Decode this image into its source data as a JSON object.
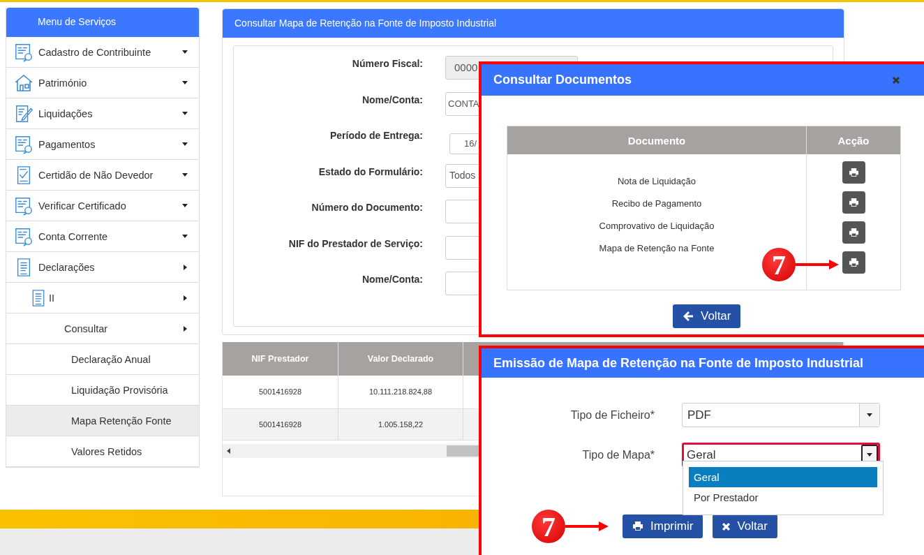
{
  "sidebar": {
    "title": "Menu de Serviços",
    "items": [
      {
        "label": "Cadastro de Contribuinte",
        "expanded": false,
        "selected": false
      },
      {
        "label": "Património",
        "expanded": false,
        "selected": false
      },
      {
        "label": "Liquidações",
        "expanded": false,
        "selected": false
      },
      {
        "label": "Pagamentos",
        "expanded": false,
        "selected": false
      },
      {
        "label": "Certidão de Não Devedor",
        "expanded": false,
        "selected": false
      },
      {
        "label": "Verificar Certificado",
        "expanded": false,
        "selected": false
      },
      {
        "label": "Conta Corrente",
        "expanded": false,
        "selected": false
      },
      {
        "label": "Declarações",
        "expanded": true,
        "selected": false,
        "children": [
          {
            "label": "II",
            "expanded": true,
            "selected": false,
            "children": [
              {
                "label": "Consultar",
                "expanded": true,
                "selected": false,
                "children": [
                  {
                    "label": "Declaração Anual",
                    "selected": false
                  },
                  {
                    "label": "Liquidação Provisória",
                    "selected": false
                  },
                  {
                    "label": "Mapa Retenção Fonte",
                    "selected": true
                  },
                  {
                    "label": "Valores Retidos",
                    "selected": false
                  }
                ]
              }
            ]
          }
        ]
      }
    ]
  },
  "panel": {
    "title": "Consultar Mapa de Retenção na Fonte de Imposto Industrial",
    "fields": [
      {
        "label": "Número Fiscal:",
        "value": "0000",
        "kind": "readonly"
      },
      {
        "label": "Nome/Conta:",
        "value": "CONTA",
        "kind": "text"
      },
      {
        "label": "Período de Entrega:",
        "value": "16/",
        "kind": "date"
      },
      {
        "label": "Estado do Formulário:",
        "value": "Todos",
        "kind": "select"
      },
      {
        "label": "Número do Documento:",
        "kind": "text"
      },
      {
        "label": "NIF do Prestador de Serviço:",
        "kind": "text"
      },
      {
        "label": "Nome/Conta:",
        "kind": "text"
      }
    ]
  },
  "table": {
    "columns": [
      "NIF Prestador",
      "Valor Declarado"
    ],
    "rows": [
      [
        "5001416928",
        "10.111.218.824,88"
      ],
      [
        "5001416928",
        "1.005.158,22"
      ]
    ]
  },
  "documents_dialog": {
    "title": "Consultar Documentos",
    "columns": [
      "Documento",
      "Acção"
    ],
    "documents": [
      "Nota de Liquidação",
      "Recibo de Pagamento",
      "Comprovativo de Liquidação",
      "Mapa de Retenção na Fonte"
    ],
    "step_badge": "7",
    "back_button": "Voltar"
  },
  "emission_dialog": {
    "title": "Emissão de Mapa de Retenção na Fonte de Imposto Industrial",
    "file_type": {
      "label": "Tipo de Ficheiro*",
      "value": "PDF"
    },
    "map_type": {
      "label": "Tipo de Mapa*",
      "value": "Geral",
      "expanded": true,
      "options": [
        {
          "label": "Geral",
          "selected": true
        },
        {
          "label": "Por Prestador",
          "selected": false
        }
      ]
    },
    "step_badge": "7",
    "print_button": "Imprimir",
    "back_button": "Voltar"
  }
}
